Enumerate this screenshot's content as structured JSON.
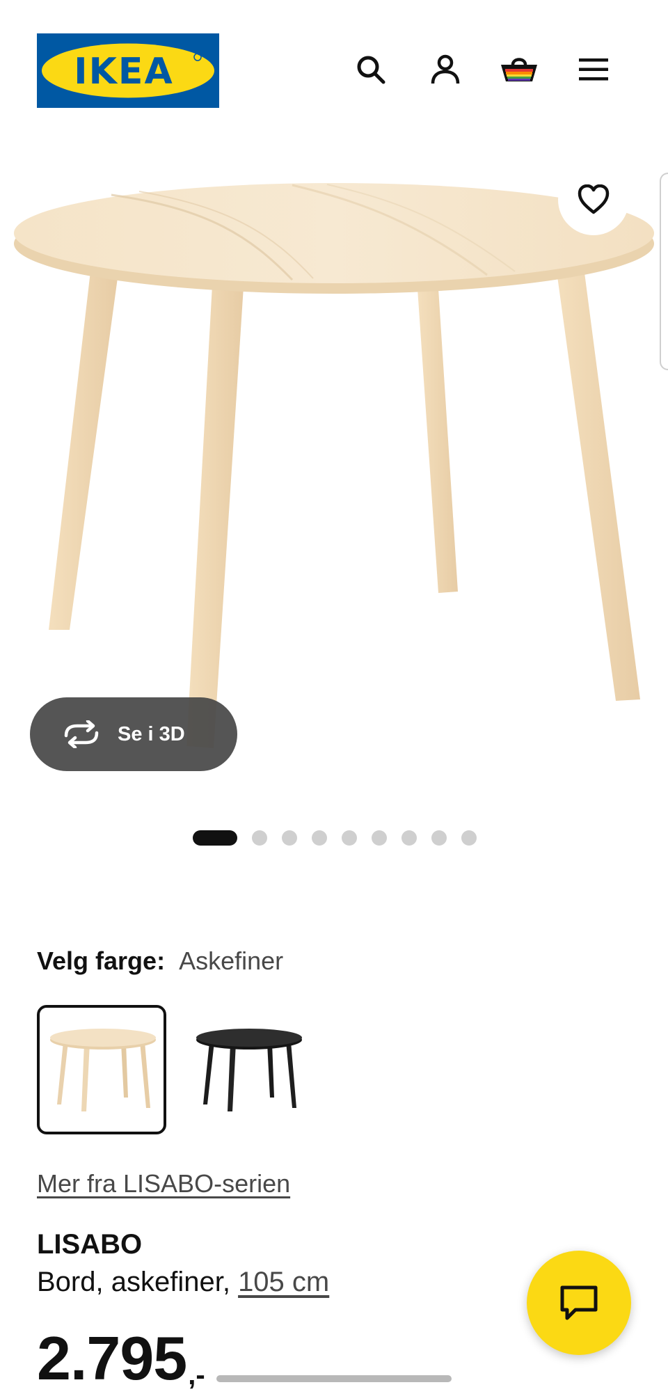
{
  "header": {
    "logo_text": "IKEA",
    "icons": [
      "search-icon",
      "profile-icon",
      "cart-icon",
      "menu-icon"
    ]
  },
  "gallery": {
    "see_3d_label": "Se i 3D",
    "image_count": 9,
    "active_index": 0
  },
  "color": {
    "label": "Velg farge:",
    "selected": "Askefiner",
    "options": [
      "Askefiner",
      "Svart"
    ]
  },
  "series_link": "Mer fra LISABO-serien",
  "product": {
    "name": "LISABO",
    "desc_prefix": "Bord, askefiner,",
    "size_link": "105 cm",
    "price_amount": "2.795",
    "price_suffix": ",-"
  },
  "colors": {
    "ikea_blue": "#0058a3",
    "ikea_yellow": "#fbd914",
    "wood": "#f1ddbf"
  }
}
